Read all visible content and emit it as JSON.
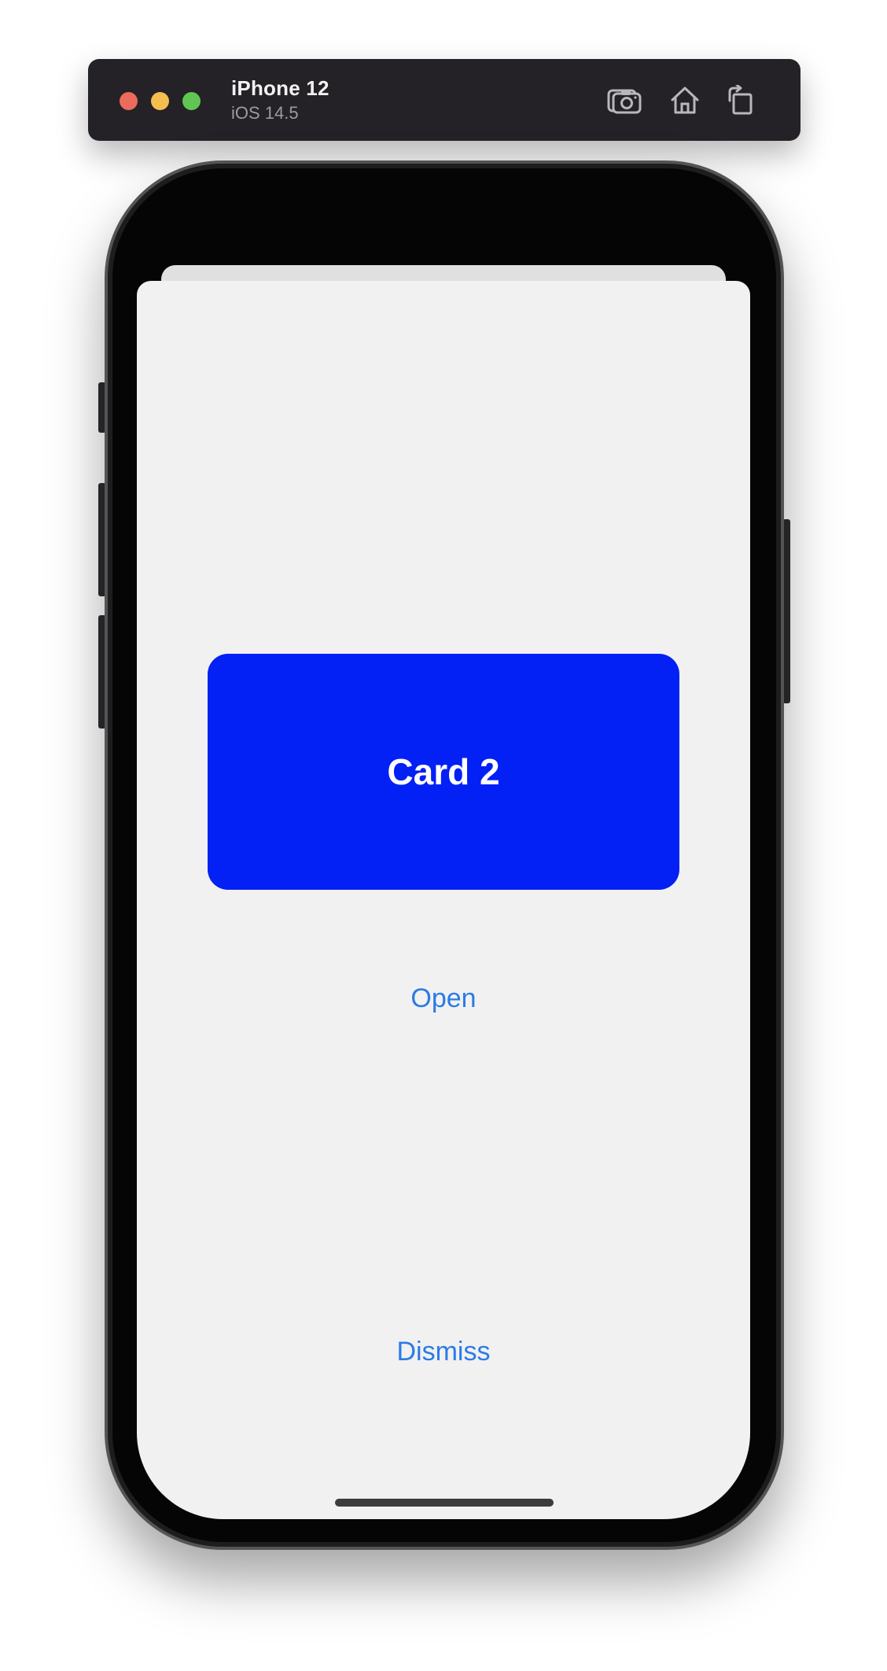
{
  "window": {
    "device_name": "iPhone 12",
    "os_version": "iOS 14.5",
    "traffic_lights": {
      "close": "#ec6a5e",
      "minimize": "#f4bf4f",
      "zoom": "#61c554"
    },
    "icons": [
      "screenshot-icon",
      "home-icon",
      "rotate-icon"
    ]
  },
  "screen": {
    "card": {
      "label": "Card 2",
      "color": "#0320f5"
    },
    "open_button": "Open",
    "dismiss_button": "Dismiss",
    "accent": "#2c7be5",
    "background": "#f1f1f2"
  }
}
